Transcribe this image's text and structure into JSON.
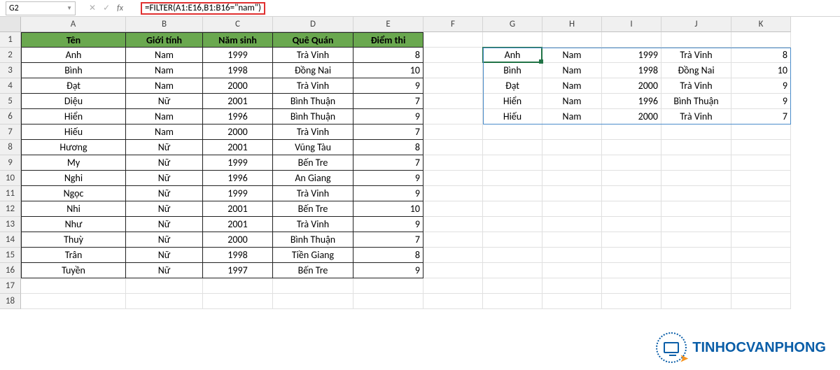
{
  "nameBox": {
    "value": "G2"
  },
  "formula": {
    "value": "=FILTER(A1:E16,B1:B16=\"nam\")"
  },
  "columns": [
    "A",
    "B",
    "C",
    "D",
    "E",
    "F",
    "G",
    "H",
    "I",
    "J",
    "K"
  ],
  "rowCount": 18,
  "headers": {
    "A": "Tên",
    "B": "Giới tính",
    "C": "Năm sinh",
    "D": "Quê Quán",
    "E": "Điểm thi"
  },
  "table": [
    {
      "A": "Anh",
      "B": "Nam",
      "C": "1999",
      "D": "Trà Vinh",
      "E": "8"
    },
    {
      "A": "Bình",
      "B": "Nam",
      "C": "1998",
      "D": "Đồng Nai",
      "E": "10"
    },
    {
      "A": "Đạt",
      "B": "Nam",
      "C": "2000",
      "D": "Trà Vinh",
      "E": "9"
    },
    {
      "A": "Diệu",
      "B": "Nữ",
      "C": "2001",
      "D": "Bình Thuận",
      "E": "7"
    },
    {
      "A": "Hiển",
      "B": "Nam",
      "C": "1996",
      "D": "Bình Thuận",
      "E": "9"
    },
    {
      "A": "Hiếu",
      "B": "Nam",
      "C": "2000",
      "D": "Trà Vinh",
      "E": "7"
    },
    {
      "A": "Hương",
      "B": "Nữ",
      "C": "2001",
      "D": "Vũng Tàu",
      "E": "8"
    },
    {
      "A": "My",
      "B": "Nữ",
      "C": "1999",
      "D": "Bến Tre",
      "E": "7"
    },
    {
      "A": "Nghi",
      "B": "Nữ",
      "C": "1996",
      "D": "An Giang",
      "E": "9"
    },
    {
      "A": "Ngọc",
      "B": "Nữ",
      "C": "1999",
      "D": "Trà Vinh",
      "E": "9"
    },
    {
      "A": "Nhi",
      "B": "Nữ",
      "C": "2001",
      "D": "Bến Tre",
      "E": "10"
    },
    {
      "A": "Như",
      "B": "Nữ",
      "C": "2001",
      "D": "Trà Vinh",
      "E": "9"
    },
    {
      "A": "Thuỳ",
      "B": "Nữ",
      "C": "2000",
      "D": "Bình Thuận",
      "E": "7"
    },
    {
      "A": "Trân",
      "B": "Nữ",
      "C": "1998",
      "D": "Tiền Giang",
      "E": "8"
    },
    {
      "A": "Tuyền",
      "B": "Nữ",
      "C": "1997",
      "D": "Bến Tre",
      "E": "9"
    }
  ],
  "filterResult": [
    {
      "G": "Anh",
      "H": "Nam",
      "I": "1999",
      "J": "Trà Vinh",
      "K": "8"
    },
    {
      "G": "Bình",
      "H": "Nam",
      "I": "1998",
      "J": "Đồng Nai",
      "K": "10"
    },
    {
      "G": "Đạt",
      "H": "Nam",
      "I": "2000",
      "J": "Trà Vinh",
      "K": "9"
    },
    {
      "G": "Hiển",
      "H": "Nam",
      "I": "1996",
      "J": "Bình Thuận",
      "K": "9"
    },
    {
      "G": "Hiếu",
      "H": "Nam",
      "I": "2000",
      "J": "Trà Vinh",
      "K": "7"
    }
  ],
  "colors": {
    "headerBg": "#6aa84f",
    "accent": "#217346",
    "spill": "#4a8cca",
    "highlight": "#e03030"
  },
  "watermark": {
    "text": "TINHOCVANPHONG"
  },
  "chart_data": null
}
